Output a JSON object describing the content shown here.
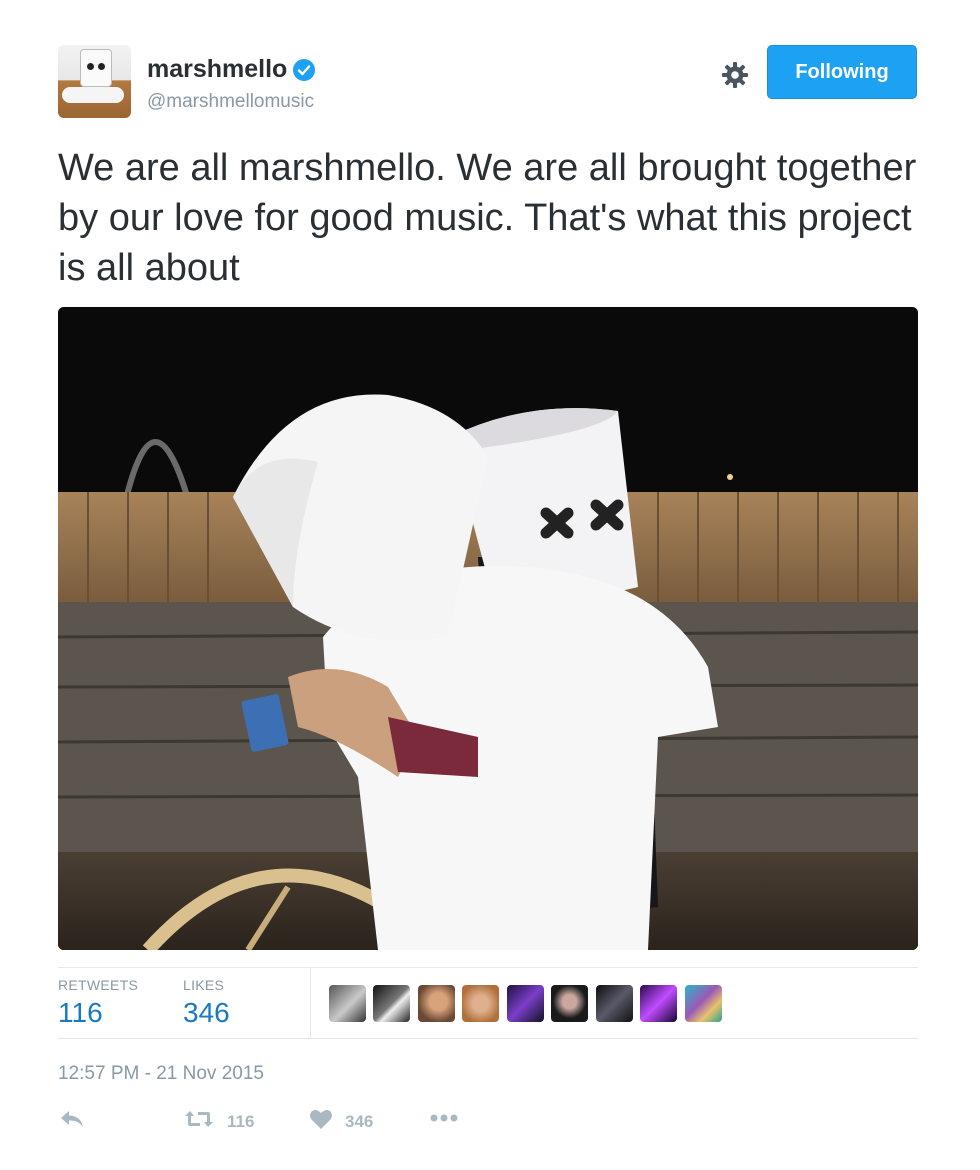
{
  "user": {
    "display_name": "marshmello",
    "handle": "@marshmellomusic",
    "verified": true
  },
  "follow_button": {
    "label": "Following"
  },
  "tweet": {
    "text": "We are all marshmello. We are all brought together by our love for good music. That's what this project is all about"
  },
  "stats": {
    "retweets_label": "RETWEETS",
    "retweets_count": "116",
    "likes_label": "LIKES",
    "likes_count": "346"
  },
  "timestamp": "12:57 PM - 21 Nov 2015",
  "actions": {
    "retweet_count": "116",
    "like_count": "346"
  },
  "colors": {
    "accent": "#1da1f2",
    "stat_number": "#1b7abf",
    "muted": "#8899a6",
    "icon": "#aab8c2"
  },
  "icons": [
    "verified-badge-icon",
    "gear-icon",
    "reply-icon",
    "retweet-icon",
    "heart-icon",
    "more-icon"
  ]
}
